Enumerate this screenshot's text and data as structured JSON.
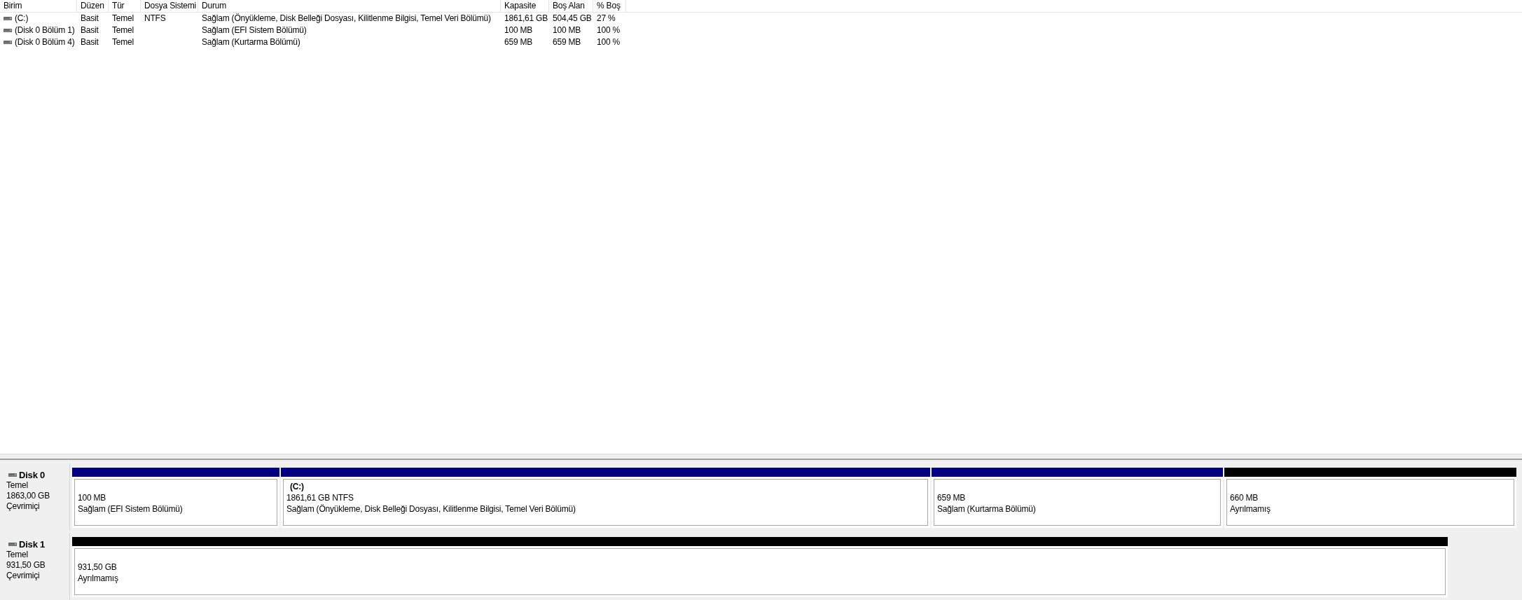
{
  "volume_list": {
    "columns": [
      "Birim",
      "Düzen",
      "Tür",
      "Dosya Sistemi",
      "Durum",
      "Kapasite",
      "Boş Alan",
      "% Boş"
    ],
    "rows": [
      {
        "volume": "(C:)",
        "layout": "Basit",
        "type": "Temel",
        "file_system": "NTFS",
        "status": "Sağlam (Önyükleme, Disk Belleği Dosyası, Kilitlenme Bilgisi, Temel Veri Bölümü)",
        "capacity": "1861,61 GB",
        "free_space": "504,45 GB",
        "percent_free": "27 %"
      },
      {
        "volume": "(Disk 0 Bölüm 1)",
        "layout": "Basit",
        "type": "Temel",
        "status": "Sağlam (EFI Sistem Bölümü)",
        "capacity": "100 MB",
        "free_space": "100 MB",
        "percent_free": "100 %"
      },
      {
        "volume": "(Disk 0 Bölüm 4)",
        "layout": "Basit",
        "type": "Temel",
        "status": "Sağlam (Kurtarma Bölümü)",
        "capacity": "659 MB",
        "free_space": "659 MB",
        "percent_free": "100 %"
      }
    ]
  },
  "disks": [
    {
      "name": "Disk 0",
      "type": "Temel",
      "size": "1863,00 GB",
      "status": "Çevrimiçi",
      "partitions": [
        {
          "size": "100 MB",
          "status": "Sağlam (EFI Sistem Bölümü)",
          "color": "#000080"
        },
        {
          "label": "(C:)",
          "size": "1861,61 GB NTFS",
          "status": "Sağlam (Önyükleme, Disk Belleği Dosyası, Kilitlenme Bilgisi, Temel Veri Bölümü)",
          "color": "#000080"
        },
        {
          "size": "659 MB",
          "status": "Sağlam (Kurtarma Bölümü)",
          "color": "#000080"
        },
        {
          "size": "660 MB",
          "status": "Ayrılmamış",
          "color": "#000000"
        }
      ]
    },
    {
      "name": "Disk 1",
      "type": "Temel",
      "size": "931,50 GB",
      "status": "Çevrimiçi",
      "partitions": [
        {
          "size": "931,50 GB",
          "status": "Ayrılmamış",
          "color": "#000000"
        }
      ]
    }
  ]
}
